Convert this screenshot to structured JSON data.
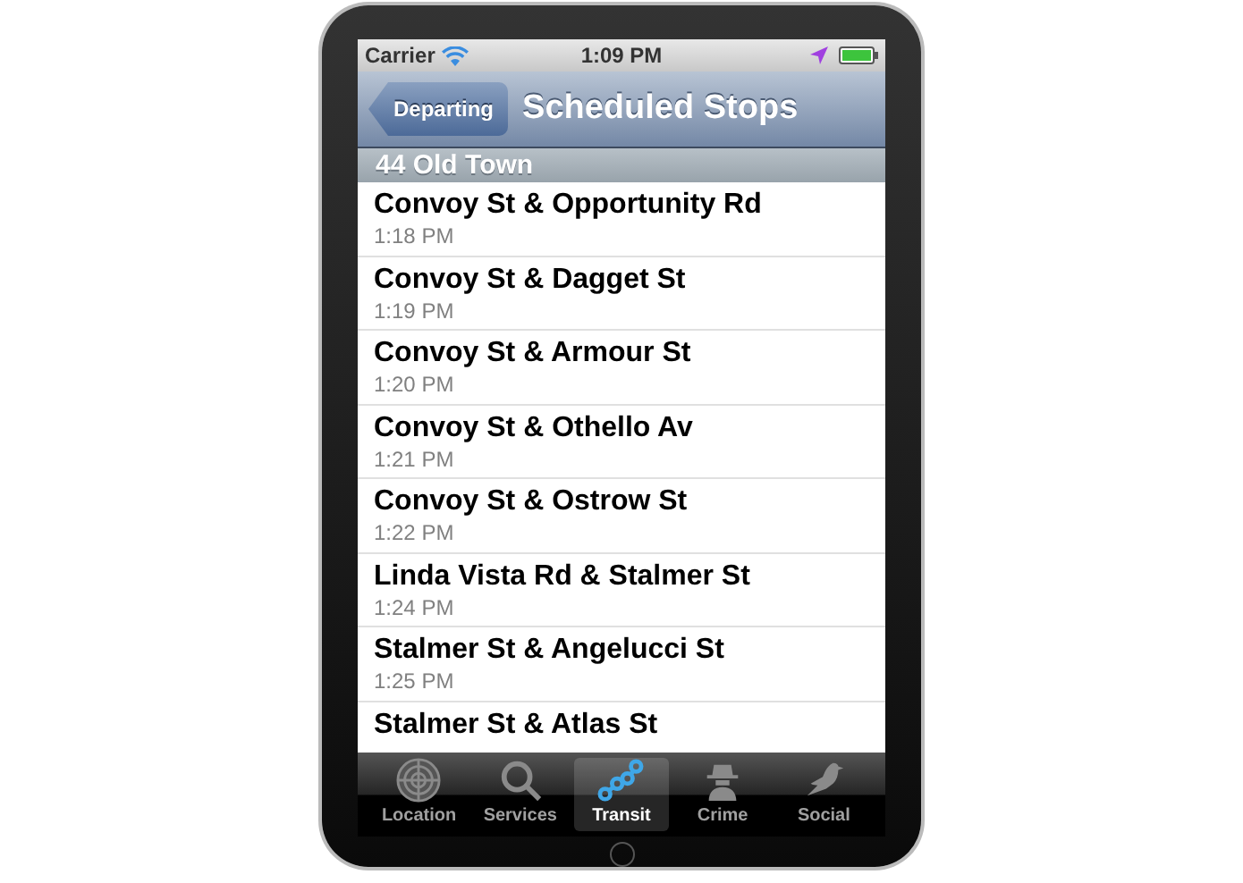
{
  "status_bar": {
    "carrier": "Carrier",
    "time": "1:09 PM"
  },
  "nav_bar": {
    "back_button": "Departing",
    "title": "Scheduled Stops"
  },
  "section": {
    "title": "44 Old Town"
  },
  "stops": [
    {
      "name": "Convoy St & Opportunity Rd",
      "time": "1:18 PM"
    },
    {
      "name": "Convoy St & Dagget St",
      "time": "1:19 PM"
    },
    {
      "name": "Convoy St & Armour St",
      "time": "1:20 PM"
    },
    {
      "name": "Convoy St & Othello Av",
      "time": "1:21 PM"
    },
    {
      "name": "Convoy St & Ostrow St",
      "time": "1:22 PM"
    },
    {
      "name": "Linda Vista Rd & Stalmer St",
      "time": "1:24 PM"
    },
    {
      "name": "Stalmer St & Angelucci St",
      "time": "1:25 PM"
    },
    {
      "name": "Stalmer St & Atlas St"
    }
  ],
  "tabs": [
    {
      "label": "Location",
      "kind": "radar",
      "selected": false
    },
    {
      "label": "Services",
      "kind": "search",
      "selected": false
    },
    {
      "label": "Transit",
      "kind": "route",
      "selected": true
    },
    {
      "label": "Crime",
      "kind": "spy",
      "selected": false
    },
    {
      "label": "Social",
      "kind": "bird",
      "selected": false
    }
  ]
}
